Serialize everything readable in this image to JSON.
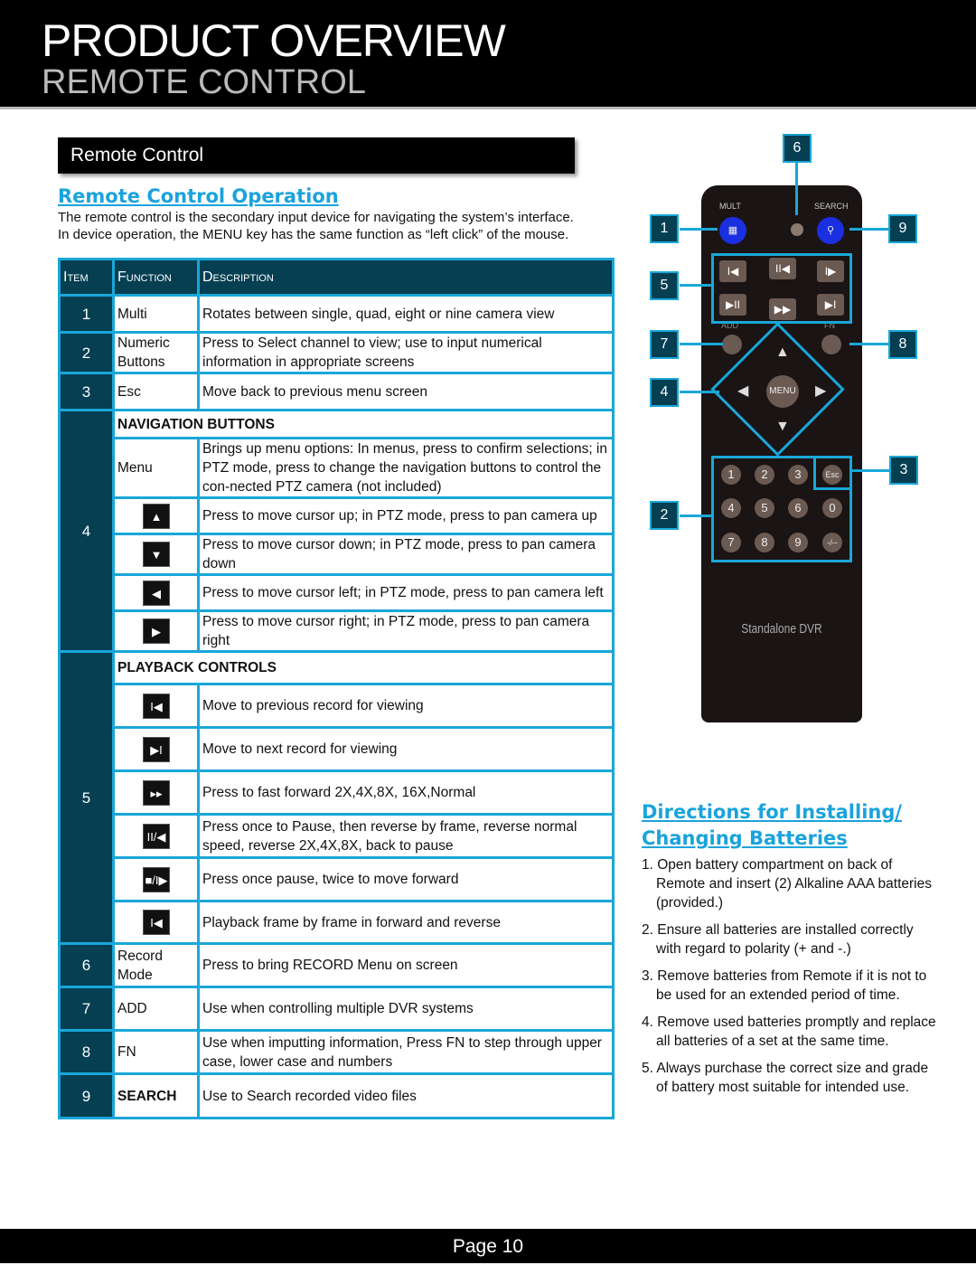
{
  "header": {
    "title": "PRODUCT OVERVIEW",
    "subtitle": "REMOTE CONTROL"
  },
  "section_title": "Remote Control",
  "operation": {
    "heading": "Remote Control Operation",
    "text1": "The remote control is the secondary input device for navigating the system’s interface.",
    "text2": "In device operation, the MENU key has the same function as “left click” of the mouse."
  },
  "table": {
    "headers": [
      "Item",
      "Function",
      "Description"
    ],
    "rows": [
      {
        "item": "1",
        "function": "Multi",
        "description": "Rotates between single, quad, eight or nine camera view"
      },
      {
        "item": "2",
        "function": "Numeric Buttons",
        "description": "Press to Select channel to view; use to input numerical information in appropriate screens"
      },
      {
        "item": "3",
        "function": "Esc",
        "description": "Move back to previous menu screen"
      }
    ],
    "nav": {
      "item": "4",
      "heading": "NAVIGATION BUTTONS",
      "rows": [
        {
          "function": "Menu",
          "description": "Brings up menu options: In menus, press to confirm selections; in PTZ mode, press to change the navigation buttons to control the con-nected PTZ camera (not included)"
        },
        {
          "icon": "up-arrow-icon",
          "glyph": "▲",
          "description": "Press to move cursor up; in PTZ mode, press to pan camera up"
        },
        {
          "icon": "down-arrow-icon",
          "glyph": "▼",
          "description": "Press to move cursor down; in PTZ mode, press to pan camera down"
        },
        {
          "icon": "left-arrow-icon",
          "glyph": "◀",
          "description": "Press to move cursor left; in PTZ mode, press to pan camera left"
        },
        {
          "icon": "right-arrow-icon",
          "glyph": "▶",
          "description": "Press to move cursor right; in PTZ mode, press to pan camera right"
        }
      ]
    },
    "playback": {
      "item": "5",
      "heading": "PLAYBACK CONTROLS",
      "rows": [
        {
          "icon": "previous-icon",
          "glyph": "I◀",
          "description": "Move to previous record for viewing"
        },
        {
          "icon": "next-icon",
          "glyph": "▶I",
          "description": "Move to next record for viewing"
        },
        {
          "icon": "fast-forward-icon",
          "glyph": "▸▸",
          "description": "Press to fast forward 2X,4X,8X, 16X,Normal"
        },
        {
          "icon": "pause-reverse-icon",
          "glyph": "II/◀",
          "description": "Press once to Pause, then reverse by frame, reverse normal speed, reverse 2X,4X,8X, back to pause"
        },
        {
          "icon": "pause-forward-icon",
          "glyph": "■/I▶",
          "description": "Press once pause, twice to move forward"
        },
        {
          "icon": "frame-icon",
          "glyph": "I◀",
          "description": "Playback frame by frame in forward and reverse"
        }
      ]
    },
    "rows2": [
      {
        "item": "6",
        "function": "Record Mode",
        "description": "Press to bring RECORD Menu on screen"
      },
      {
        "item": "7",
        "function": "ADD",
        "description": "Use when controlling multiple DVR systems"
      },
      {
        "item": "8",
        "function": "FN",
        "description": "Use when imputting information, Press FN to step through upper case, lower case and numbers"
      },
      {
        "item": "9",
        "function": "SEARCH",
        "description": "Use to Search recorded video files"
      }
    ]
  },
  "remote": {
    "mult": "MULT",
    "search": "SEARCH",
    "add": "ADD",
    "fn": "FN",
    "menu": "MENU",
    "esc": "Esc",
    "brand": "Standalone DVR",
    "keys": [
      "1",
      "2",
      "3",
      "4",
      "5",
      "6",
      "0",
      "7",
      "8",
      "9",
      "-/--"
    ],
    "callouts": [
      "1",
      "2",
      "3",
      "4",
      "5",
      "6",
      "7",
      "8",
      "9"
    ]
  },
  "batteries": {
    "heading1": "Directions for Installing/",
    "heading2": "Changing Batteries",
    "steps": [
      "1. Open battery compartment on back of Remote and insert (2) Alkaline AAA batteries (provided.)",
      "2. Ensure all batteries are installed correctly with regard to polarity (+ and -.)",
      "3. Remove batteries from Remote if it is not to be used for an extended period of time.",
      "4. Remove used batteries promptly and replace all batteries of a set at the same time.",
      "5. Always purchase the correct size and grade of battery most suitable for intended use."
    ]
  },
  "footer": {
    "page": "Page  10"
  },
  "colors": {
    "accent": "#19a7d8",
    "dark": "#063f52"
  }
}
